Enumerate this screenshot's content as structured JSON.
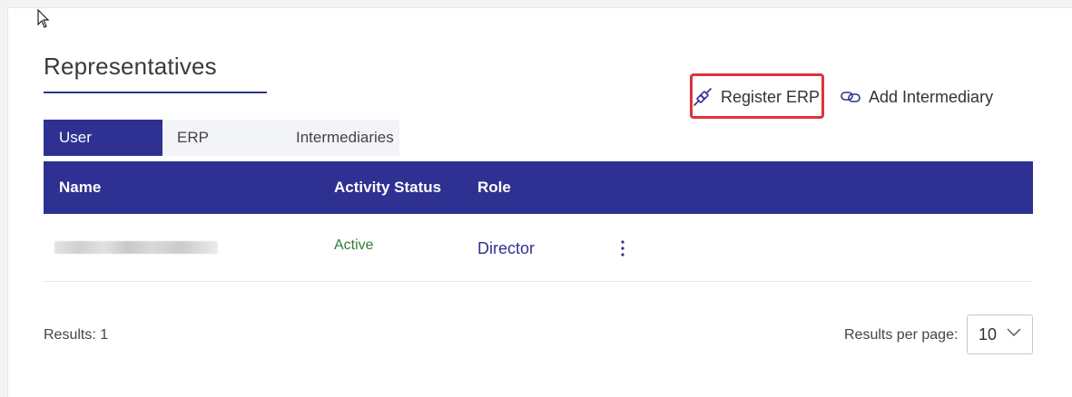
{
  "header": {
    "title": "Representatives"
  },
  "actions": {
    "register_erp": "Register ERP",
    "add_intermediary": "Add Intermediary",
    "highlight_color": "#e0323a"
  },
  "tabs": [
    {
      "label": "User",
      "active": true
    },
    {
      "label": "ERP",
      "active": false
    },
    {
      "label": "Intermediaries",
      "active": false
    }
  ],
  "table": {
    "columns": [
      "Name",
      "Activity Status",
      "Role"
    ],
    "rows": [
      {
        "name": "",
        "status": "Active",
        "role": "Director"
      }
    ]
  },
  "footer": {
    "results": "Results: 1",
    "per_page_label": "Results per page:",
    "per_page_value": "10"
  },
  "colors": {
    "primary": "#2e3192",
    "active_status": "#2e7d32"
  },
  "icons": {
    "register": "plug-link-icon",
    "add": "chain-link-icon",
    "row_menu": "kebab-menu-icon",
    "select": "chevron-down-icon",
    "cursor": "mouse-pointer-icon"
  }
}
